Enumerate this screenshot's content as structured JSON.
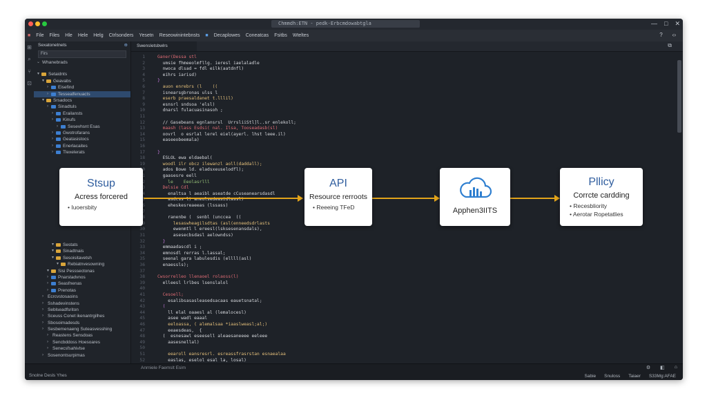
{
  "window": {
    "search_text": "Chmmdh:ETN - pedk-Erbcmdowabtgla",
    "controls": [
      "—",
      "□",
      "✕"
    ]
  },
  "menubar": {
    "items": [
      "File",
      "Files",
      "Hle",
      "Hele",
      "Helg",
      "Ctrlsonders",
      "Yesetn",
      "Reseowinintebnsts",
      "Decaplowes",
      "Coneatcas",
      "Fsitbs",
      "Wteltes"
    ],
    "right_icons": [
      "?",
      "‹›"
    ]
  },
  "sidebar": {
    "header": "Sexatonetnets",
    "filter_value": "Firs",
    "root": "Whanebrads",
    "items": [
      {
        "label": "Setaidnts",
        "depth": 1,
        "icon": "folder"
      },
      {
        "label": "Geavabs",
        "depth": 2,
        "icon": "folder"
      },
      {
        "label": "Eisefind",
        "depth": 3,
        "icon": "file"
      },
      {
        "label": "Tessealfenuacts",
        "depth": 3,
        "icon": "file",
        "selected": true
      },
      {
        "label": "Srsadocs",
        "depth": 2,
        "icon": "folder"
      },
      {
        "label": "Sinadtuls",
        "depth": 3,
        "icon": "file"
      },
      {
        "label": "Erailansts",
        "depth": 4,
        "icon": "file"
      },
      {
        "label": "Kinufs",
        "depth": 4,
        "icon": "file"
      },
      {
        "label": "Sesevhsnt Esas",
        "depth": 5,
        "icon": "file"
      },
      {
        "label": "Gwotrofarans",
        "depth": 4,
        "icon": "file"
      },
      {
        "label": "Geatasistocs",
        "depth": 4,
        "icon": "file"
      },
      {
        "label": "Enerlacaites",
        "depth": 4,
        "icon": "file"
      },
      {
        "label": "Tlexelerats",
        "depth": 4,
        "icon": "file"
      }
    ],
    "items_lower": [
      {
        "label": "Sestats",
        "depth": 4,
        "icon": "folder"
      },
      {
        "label": "Sinadtnais",
        "depth": 4,
        "icon": "folder"
      },
      {
        "label": "Sesoisitavetsh",
        "depth": 4,
        "icon": "folder"
      },
      {
        "label": "Rebiatnvesowning",
        "depth": 5,
        "icon": "folder"
      },
      {
        "label": "Sisi Pesssectonas",
        "depth": 3,
        "icon": "folder"
      },
      {
        "label": "Pnarstadvnos",
        "depth": 3,
        "icon": "file"
      },
      {
        "label": "Seasfnenas",
        "depth": 3,
        "icon": "file"
      },
      {
        "label": "Prenotas",
        "depth": 3,
        "icon": "file"
      },
      {
        "label": "Ecrcvstosaoins",
        "depth": 2,
        "icon": "none"
      },
      {
        "label": "Sshadevinstens",
        "depth": 2,
        "icon": "none"
      },
      {
        "label": "Seblseadfsriton",
        "depth": 2,
        "icon": "none"
      },
      {
        "label": "Sceuss Conet ikenantrgilhes",
        "depth": 2,
        "icon": "none"
      },
      {
        "label": "Sbosoimadesds",
        "depth": 2,
        "icon": "none"
      },
      {
        "label": "Sesbemenaeng Suteasvesshing",
        "depth": 2,
        "icon": "none"
      },
      {
        "label": "Reastens Sensdoas",
        "depth": 3,
        "icon": "none"
      },
      {
        "label": "Sencbddoss Hoesoares",
        "depth": 3,
        "icon": "none"
      },
      {
        "label": "Senecsfsahivlse",
        "depth": 3,
        "icon": "none"
      },
      {
        "label": "Sosenontsurpimas",
        "depth": 2,
        "icon": "none"
      }
    ]
  },
  "editor": {
    "tab_label": "Swensletsbwlrs",
    "tab_icons": [
      "⧉",
      "⋯"
    ],
    "lines": [
      {
        "text": "Ganer(Dessa stl",
        "color": "#e06c75"
      },
      {
        "text": "  umsie fhmeeolmfllg. ieresl iaelaladle",
        "color": "#d7d9de"
      },
      {
        "text": "  nwoca dlsad = fdl eilk(aatdnfl)",
        "color": "#d7d9de"
      },
      {
        "text": "  eihrs iarisd)",
        "color": "#d7d9de"
      },
      {
        "text": "}",
        "color": "#c678dd"
      },
      {
        "text": "  auon enrebrs (l    ((",
        "color": "#e5c07b"
      },
      {
        "text": "  isnearsgbronas ulss l",
        "color": "#d7d9de"
      },
      {
        "text": "  eserb praesaldanet t.lllil)",
        "color": "#e5c07b"
      },
      {
        "text": "  esnsrl sndsoa 'elsl)",
        "color": "#d7d9de"
      },
      {
        "text": "  dnarsl fulacuasinasoh ;",
        "color": "#d7d9de"
      },
      {
        "text": "",
        "color": "#d7d9de"
      },
      {
        "text": "  // Gasebeans egnlansrsl  UrrsliiStl]l..sr enlekoll;",
        "color": "#d7d9de"
      },
      {
        "text": "  maash (lass Esdsi( nal. Ilsa, Tooseadasb(sl)",
        "color": "#e06c75"
      },
      {
        "text": "  oovrl  o esrlal lerel eiel(ayerl. lhst leee.il)",
        "color": "#d7d9de"
      },
      {
        "text": "  easeeobeemala)",
        "color": "#d7d9de"
      },
      {
        "text": "",
        "color": "#d7d9de"
      },
      {
        "text": "}",
        "color": "#c678dd"
      },
      {
        "text": "  ESLOL ewa eldaebal(",
        "color": "#d7d9de"
      },
      {
        "text": "  woodl ilr obcz ilewanzl aoll(daddall);",
        "color": "#e5c07b"
      },
      {
        "text": "  ados Bowe ld. eladsxeuselodfl);",
        "color": "#d7d9de"
      },
      {
        "text": "  gaasesre eell",
        "color": "#d7d9de"
      },
      {
        "text": "    le    Eeolasrlll",
        "color": "#98c379"
      },
      {
        "text": "  Delsie Cdl",
        "color": "#e06c75"
      },
      {
        "text": "    enaltsa l aeaibl aseatde cCuseanearsdasdl",
        "color": "#d7d9de"
      },
      {
        "text": "    asdcss l) aneulsedeasidlassl)",
        "color": "#d7d9de"
      },
      {
        "text": "    eheskesreaeeas (lssass)",
        "color": "#d7d9de"
      },
      {
        "text": "",
        "color": "#d7d9de"
      },
      {
        "text": "    ranenbe (  senbl (unccea  ((",
        "color": "#d7d9de"
      },
      {
        "text": "      lesaswheagilsdtas (asl(enneedsdrlasts",
        "color": "#e5c07b"
      },
      {
        "text": "      ewenmtl l ereesl(lsksesenansdals),",
        "color": "#d7d9de"
      },
      {
        "text": "      asesecbsdasl aelowndss)",
        "color": "#d7d9de"
      },
      {
        "text": "  }",
        "color": "#c678dd"
      },
      {
        "text": "  emmaadascdl i ;",
        "color": "#d7d9de"
      },
      {
        "text": "  emnosdl rerras l.lassal;",
        "color": "#d7d9de"
      },
      {
        "text": "  seenal gara labulesdis (ellll(asl)",
        "color": "#d7d9de"
      },
      {
        "text": "  enaessls);",
        "color": "#d7d9de"
      },
      {
        "text": "",
        "color": "#d7d9de"
      },
      {
        "text": "Cwsorrelleo llenaoel rolaoss(l)",
        "color": "#e06c75"
      },
      {
        "text": "  elleesl lrlbes lsenslalol",
        "color": "#d7d9de"
      },
      {
        "text": "",
        "color": "#d7d9de"
      },
      {
        "text": "  Cesoell;",
        "color": "#e06c75"
      },
      {
        "text": "    esalibsasasleasedsacaas eauetsnatal;",
        "color": "#d7d9de"
      },
      {
        "text": "  (",
        "color": "#c678dd"
      },
      {
        "text": "    ll elal oaaesl al (lemalocesl)",
        "color": "#d7d9de"
      },
      {
        "text": "    asee wadl eaaal",
        "color": "#d7d9de"
      },
      {
        "text": "    eeloassa, ( alemalsaa *iaaslweasl;al;)",
        "color": "#e5c07b"
      },
      {
        "text": "    eeaesdeas,  {",
        "color": "#d7d9de"
      },
      {
        "text": "  (  esnesawl eseesell aleaesaneeee eeleee",
        "color": "#d7d9de"
      },
      {
        "text": "    aasesnellal)",
        "color": "#d7d9de"
      },
      {
        "text": "",
        "color": "#d7d9de"
      },
      {
        "text": "    eearoll eansresrl. esreassfrasrstan esnaealaa",
        "color": "#e5c07b"
      },
      {
        "text": "    easlas, eselol esal la, losal)",
        "color": "#d7d9de"
      }
    ]
  },
  "cards": {
    "setup": {
      "title": "Stsup",
      "subtitle": "Acress forcered",
      "bullets": [
        "Iuoersbity"
      ]
    },
    "api": {
      "title": "API",
      "subtitle": "Resource rerroots",
      "bullets": [
        "Reeeing TFeD"
      ]
    },
    "apphen": {
      "label": "Apphen3IITS"
    },
    "policy": {
      "title": "Pllicy",
      "subtitle": "Corrcte cardding",
      "bullets": [
        "Recesbliority",
        "Aerotar Ropetatlies"
      ]
    }
  },
  "statusbar": {
    "left": "Snolne Desls Yhes",
    "mid": "Anrniele Faemslt Esim",
    "icons": [
      "⚙",
      "◧",
      "⌂"
    ],
    "right": [
      "Sabie",
      "Snuloss",
      "Taiaer",
      "S33Mg:AFAE"
    ]
  },
  "colors": {
    "accent_arrow": "#e3a41a",
    "card_title": "#2f5d9e",
    "selection": "#2e4a6e"
  }
}
